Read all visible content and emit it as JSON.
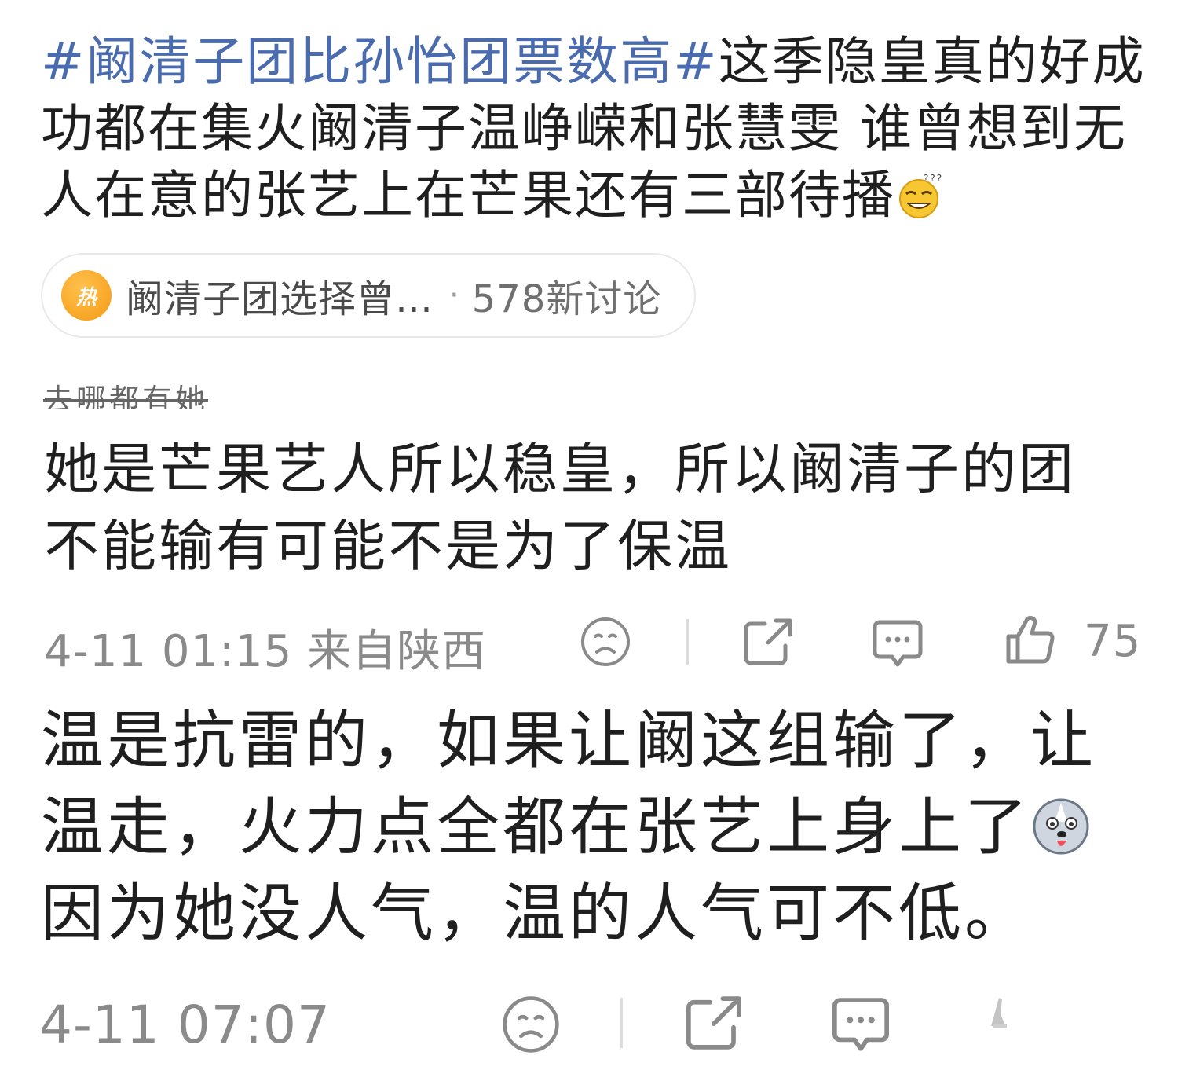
{
  "post": {
    "hashtag1": "#阚清子团比孙怡团票数高#",
    "text": "这季隐皇真的好成功都在集火阚清子温峥嵘和张慧雯  谁曾想到无人在意的张艺上在芒果还有三部待播",
    "emoji": "dizzy-grin-emoji"
  },
  "topic_card": {
    "badge": "热",
    "title": "阚清子团选择曾…",
    "separator": "·",
    "count": "578新讨论"
  },
  "comment1": {
    "quote_ref": "去哪都有她",
    "text": "她是芒果艺人所以稳皇，所以阚清子的团不能输有可能不是为了保温",
    "time": "4-11 01:15  来自陕西",
    "likes": "75"
  },
  "comment2": {
    "text_a": "温是抗雷的，如果让阚这组输了，让温走，火力点全都在张艺上身上了",
    "text_b": "因为她没人气，温的人气可不低。",
    "emoji": "husky-tongue-emoji",
    "time": "4-11 07:07"
  },
  "colors": {
    "hashtag": "#4a6cae",
    "meta": "#8a8a8a",
    "hot": "#f59a14"
  }
}
